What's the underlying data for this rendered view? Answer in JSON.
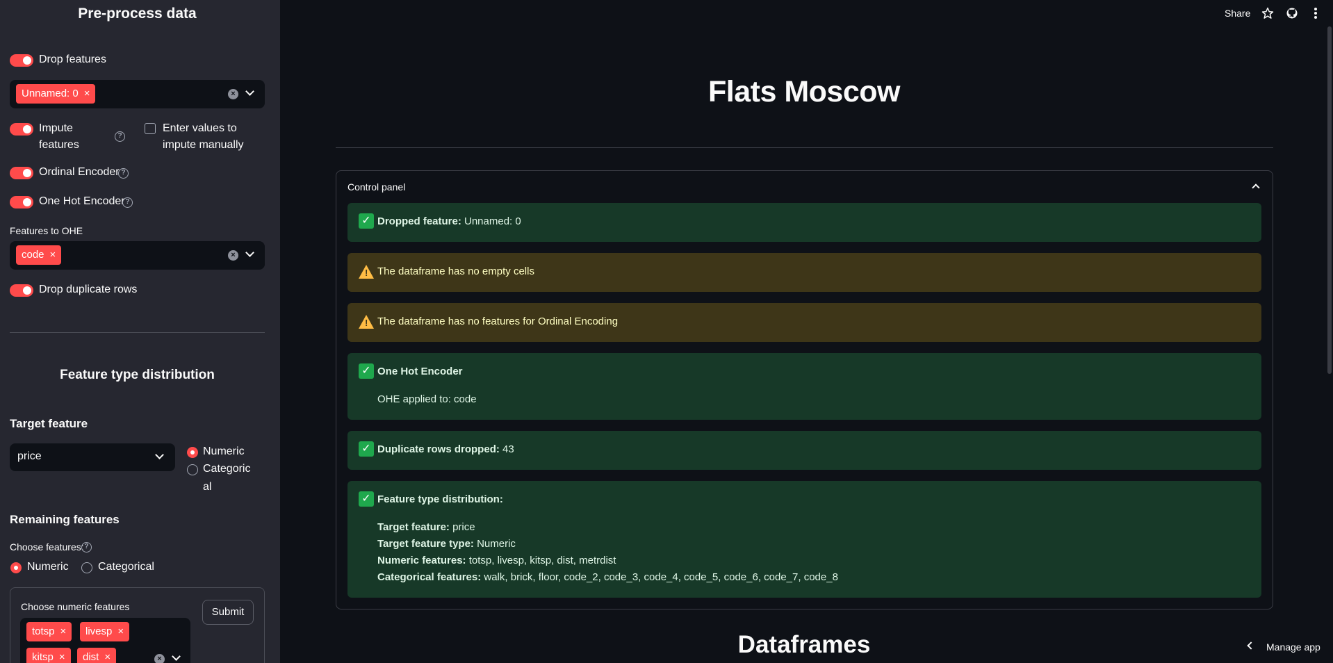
{
  "sidebar": {
    "title": "Pre-process data",
    "drop_features": {
      "label": "Drop features",
      "chips": [
        "Unnamed: 0"
      ]
    },
    "impute": {
      "label_line1": "Impute",
      "label_line2": "features",
      "manual_line1": "Enter values to",
      "manual_line2": "impute manually"
    },
    "ordinal_label": "Ordinal Encoder",
    "ohe_label": "One Hot Encoder",
    "ohe_features_label": "Features to OHE",
    "ohe_chips": [
      "code"
    ],
    "drop_dup_label": "Drop duplicate rows",
    "feature_dist_title": "Feature type distribution",
    "target_feature_heading": "Target feature",
    "target_select_value": "price",
    "target_type_options": [
      "Numeric",
      "Categoric",
      "al"
    ],
    "remaining_heading": "Remaining features",
    "choose_features_label": "Choose features:",
    "choose_options": [
      "Numeric",
      "Categorical"
    ],
    "form": {
      "label": "Choose numeric features",
      "chips": [
        "totsp",
        "livesp",
        "kitsp",
        "dist"
      ],
      "submit": "Submit"
    }
  },
  "topbar": {
    "share": "Share"
  },
  "main": {
    "title": "Flats Moscow",
    "expander_title": "Control panel",
    "alerts": {
      "dropped_bold": "Dropped feature:",
      "dropped_value": " Unnamed: 0",
      "no_empty": "The dataframe has no empty cells",
      "no_ordinal": "The dataframe has no features for Ordinal Encoding",
      "ohe_title": "One Hot Encoder",
      "ohe_applied": "OHE applied to: code",
      "dup_bold": "Duplicate rows dropped:",
      "dup_value": " 43",
      "ftd_title": "Feature type distribution:",
      "target_bold": "Target feature:",
      "target_value": " price",
      "type_bold": "Target feature type:",
      "type_value": " Numeric",
      "num_bold": "Numeric features:",
      "num_value": " totsp, livesp, kitsp, dist, metrdist",
      "cat_bold": "Categorical features:",
      "cat_value": " walk, brick, floor, code_2, code_3, code_4, code_5, code_6, code_7, code_8"
    },
    "dataframes_title": "Dataframes",
    "manage_app": "Manage app"
  },
  "colors": {
    "accent": "#ff4b4b",
    "success_bg": "#173928",
    "warning_bg": "#3e3618",
    "sidebar_bg": "#262730",
    "main_bg": "#0e1117"
  },
  "icons": [
    "help-icon",
    "close-icon",
    "chevron-down-icon",
    "star-icon",
    "github-icon",
    "kebab-menu-icon",
    "check-icon",
    "warning-icon",
    "chevron-up-icon",
    "chevron-left-icon"
  ]
}
